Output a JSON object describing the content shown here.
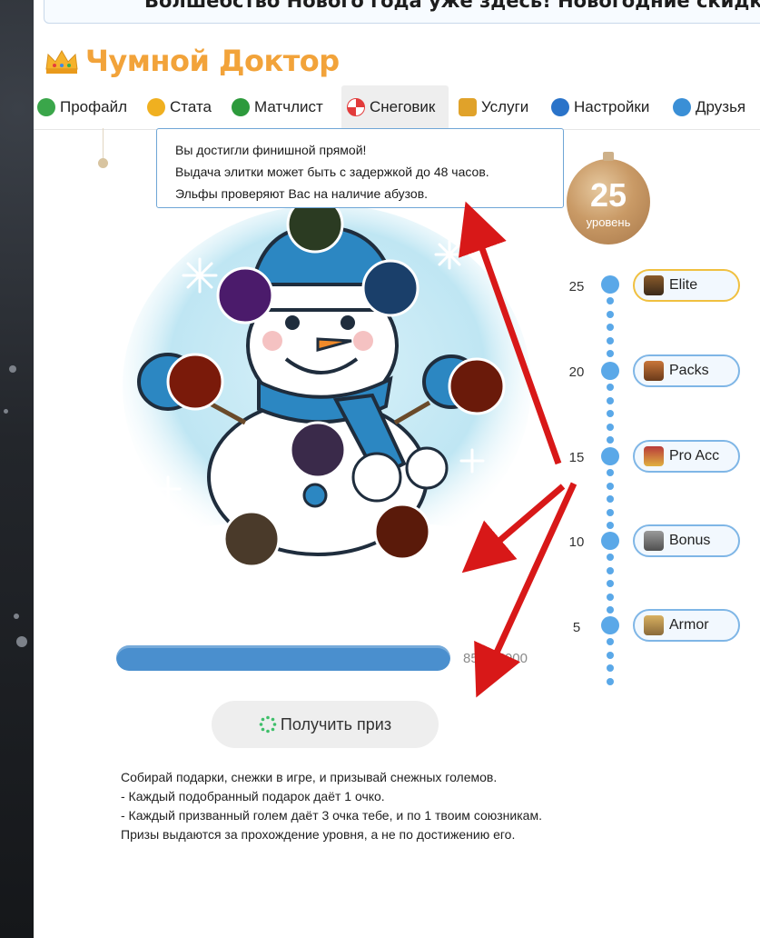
{
  "banner": {
    "text": "Волшебство Нового года уже здесь! Новогодние скидки в на"
  },
  "profile": {
    "name": "Чумной Доктор"
  },
  "tabs": [
    {
      "label": "Профайл",
      "icon": "profile-icon",
      "color": "#3aa64a"
    },
    {
      "label": "Стата",
      "icon": "stats-icon",
      "color": "#f0b020"
    },
    {
      "label": "Матчлист",
      "icon": "matchlist-icon",
      "color": "#2d9a3c"
    },
    {
      "label": "Снеговик",
      "icon": "snowman-candy-icon",
      "color": "#e23b3b",
      "active": true
    },
    {
      "label": "Услуги",
      "icon": "services-icon",
      "color": "#e0a22a"
    },
    {
      "label": "Настройки",
      "icon": "settings-icon",
      "color": "#2a73c9"
    },
    {
      "label": "Друзья",
      "icon": "friends-icon",
      "color": "#3a8fd6"
    }
  ],
  "tooltip": {
    "line1": "Вы достигли финишной прямой!",
    "line2": "Выдача элитки может быть с задержкой до 48 часов.",
    "line3": "Эльфы проверяют Вас на наличие абузов."
  },
  "level": {
    "number": "25",
    "label": "уровень"
  },
  "rewards": [
    {
      "level": "25",
      "label": "Elite",
      "icon": "elite-icon",
      "highlight": true
    },
    {
      "level": "20",
      "label": "Packs",
      "icon": "packs-icon"
    },
    {
      "level": "15",
      "label": "Pro Acc",
      "icon": "pro-acc-icon"
    },
    {
      "level": "10",
      "label": "Bonus",
      "icon": "bonus-icon"
    },
    {
      "level": "5",
      "label": "Armor",
      "icon": "armor-icon"
    }
  ],
  "progress": {
    "text": "850/75000",
    "fraction": 1.0
  },
  "prize_button": {
    "label": "Получить приз"
  },
  "description": {
    "line1": "Собирай подарки, снежки в игре, и призывай снежных големов.",
    "line2": "- Каждый подобранный подарок даёт 1 очко.",
    "line3": "- Каждый призванный голем даёт 3 очка тебе, и по 1 твоим союзникам.",
    "line4": "Призы выдаются за прохождение уровня, а не по достижению его."
  },
  "colors": {
    "accent": "#f2a33a",
    "blue": "#5aa8e8",
    "arrow": "#d81818"
  }
}
